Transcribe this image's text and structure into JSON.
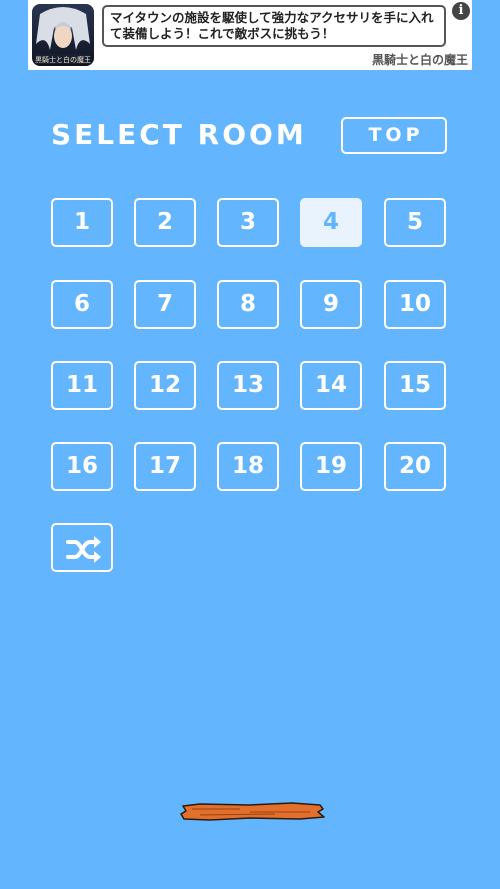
{
  "ad": {
    "text": "マイタウンの施設を駆使して強力なアクセサリを手に入れて装備しよう！これで敵ボスに挑もう！",
    "source": "黒騎士と白の魔王",
    "info_glyph": "i"
  },
  "header": {
    "title": "SELECT ROOM",
    "top_label": "TOP"
  },
  "rooms": {
    "r1": "1",
    "r2": "2",
    "r3": "3",
    "r4": "4",
    "r5": "5",
    "r6": "6",
    "r7": "7",
    "r8": "8",
    "r9": "9",
    "r10": "10",
    "r11": "11",
    "r12": "12",
    "r13": "13",
    "r14": "14",
    "r15": "15",
    "r16": "16",
    "r17": "17",
    "r18": "18",
    "r19": "19",
    "r20": "20",
    "selected": "4"
  },
  "colors": {
    "background": "#63b5fd",
    "selected_fill": "#e9f3fd",
    "plank": "#e26f2c"
  },
  "icons": {
    "shuffle": "shuffle-icon",
    "info": "info-icon",
    "plank": "wooden-plank"
  }
}
